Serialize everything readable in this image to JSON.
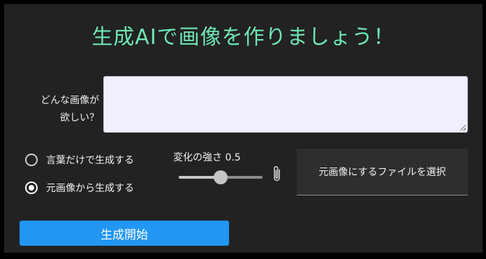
{
  "title": "生成AIで画像を作りましょう！",
  "prompt": {
    "label_line1": "どんな画像が",
    "label_line2": "欲しい？",
    "value": "",
    "placeholder": ""
  },
  "mode": {
    "options": [
      {
        "label": "言葉だけで生成する",
        "selected": false
      },
      {
        "label": "元画像から生成する",
        "selected": true
      }
    ]
  },
  "strength": {
    "label": "変化の強さ",
    "value_text": "0.5",
    "value": 0.5,
    "min": 0,
    "max": 1
  },
  "file": {
    "button_label": "元画像にするファイルを選択",
    "icon": "paperclip-icon"
  },
  "start": {
    "label": "生成開始"
  },
  "colors": {
    "title": "#6ee6b4",
    "panel": "#222222",
    "accent": "#2196f3",
    "input_bg": "#f0eeff"
  }
}
